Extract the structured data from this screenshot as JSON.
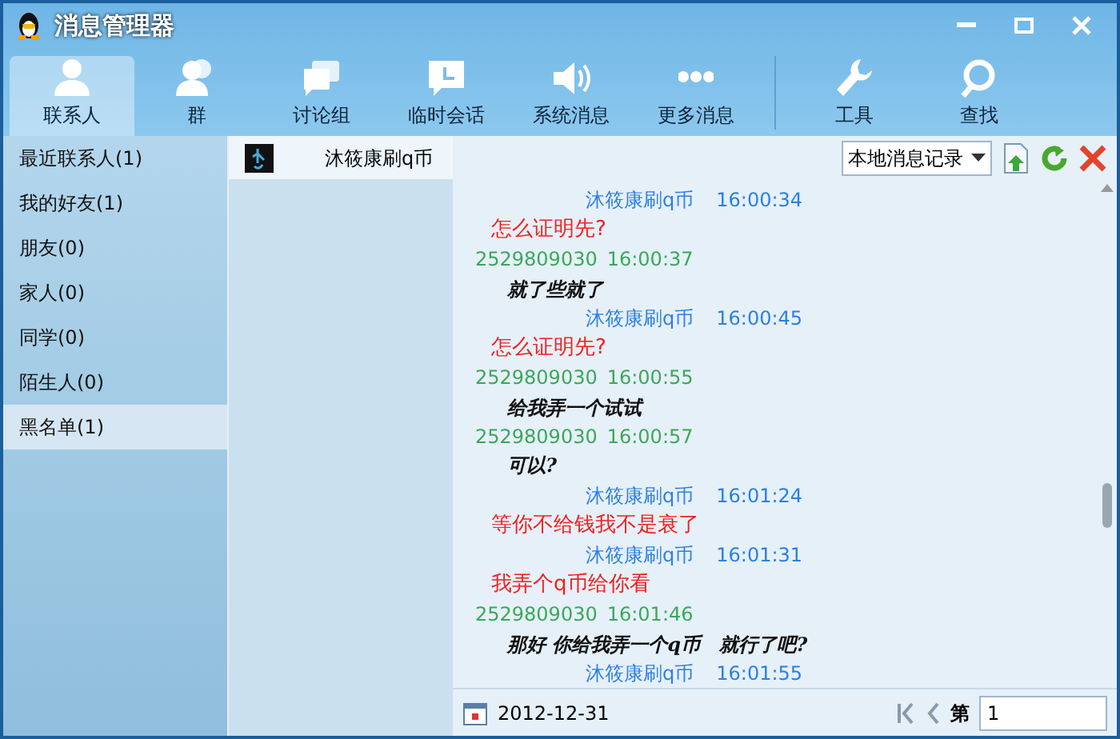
{
  "window": {
    "title": "消息管理器"
  },
  "toolbar": [
    {
      "label": "联系人",
      "selected": true
    },
    {
      "label": "群",
      "selected": false
    },
    {
      "label": "讨论组",
      "selected": false
    },
    {
      "label": "临时会话",
      "selected": false
    },
    {
      "label": "系统消息",
      "selected": false
    },
    {
      "label": "更多消息",
      "selected": false
    },
    {
      "label": "工具",
      "selected": false
    },
    {
      "label": "查找",
      "selected": false
    }
  ],
  "sidebar": {
    "items": [
      {
        "label": "最近联系人(1)",
        "selected": false
      },
      {
        "label": "我的好友(1)",
        "selected": false
      },
      {
        "label": "朋友(0)",
        "selected": false
      },
      {
        "label": "家人(0)",
        "selected": false
      },
      {
        "label": "同学(0)",
        "selected": false
      },
      {
        "label": "陌生人(0)",
        "selected": false
      },
      {
        "label": "黑名单(1)",
        "selected": true
      }
    ]
  },
  "contacts": [
    {
      "name": "沐筱康刷q币",
      "selected": true
    }
  ],
  "record_source": {
    "value": "本地消息记录"
  },
  "messages": [
    {
      "kind": "contact_header",
      "sender": "沐筱康刷q币",
      "time": "16:00:34"
    },
    {
      "kind": "contact_text",
      "text": "怎么证明先?"
    },
    {
      "kind": "self_header",
      "sender": "2529809030",
      "time": "16:00:37"
    },
    {
      "kind": "self_text",
      "text": "就了些就了"
    },
    {
      "kind": "contact_header",
      "sender": "沐筱康刷q币",
      "time": "16:00:45"
    },
    {
      "kind": "contact_text",
      "text": "怎么证明先?"
    },
    {
      "kind": "self_header",
      "sender": "2529809030",
      "time": "16:00:55"
    },
    {
      "kind": "self_text",
      "text": "给我弄一个试试"
    },
    {
      "kind": "self_header",
      "sender": "2529809030",
      "time": "16:00:57"
    },
    {
      "kind": "self_text",
      "text": "可以?"
    },
    {
      "kind": "contact_header",
      "sender": "沐筱康刷q币",
      "time": "16:01:24"
    },
    {
      "kind": "contact_text",
      "text": "等你不给钱我不是衰了"
    },
    {
      "kind": "contact_header",
      "sender": "沐筱康刷q币",
      "time": "16:01:31"
    },
    {
      "kind": "contact_text",
      "text": "我弄个q币给你看"
    },
    {
      "kind": "self_header",
      "sender": "2529809030",
      "time": "16:01:46"
    },
    {
      "kind": "self_text",
      "text": "那好 你给我弄一个q币　就行了吧?"
    },
    {
      "kind": "contact_header",
      "sender": "沐筱康刷q币",
      "time": "16:01:55"
    }
  ],
  "footer": {
    "date": "2012-12-31",
    "page_label": "第",
    "page_value": "1"
  }
}
